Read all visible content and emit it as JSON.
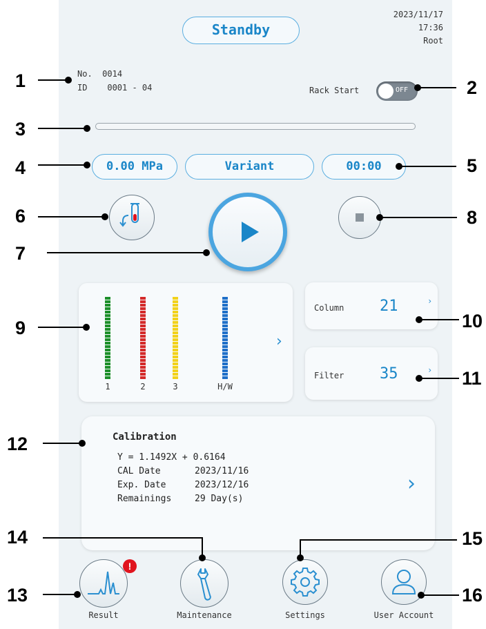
{
  "status": {
    "label": "Standby"
  },
  "header": {
    "date": "2023/11/17",
    "time": "17:36",
    "user": "Root"
  },
  "sample": {
    "no_label": "No.",
    "no_value": "0014",
    "id_label": "ID",
    "id_value": "0001 - 04"
  },
  "rack_start": {
    "label": "Rack Start",
    "toggle_text": "OFF",
    "state": "off"
  },
  "progress": {
    "value": 0
  },
  "pressure": {
    "value": "0.00 MPa"
  },
  "mode": {
    "value": "Variant"
  },
  "timer": {
    "value": "00:00"
  },
  "reagents": {
    "labels": [
      "1",
      "2",
      "3",
      "H/W"
    ],
    "colors": [
      "#1d8f2a",
      "#d42a2a",
      "#f2d21b",
      "#1f6fc8"
    ],
    "levels": [
      1.0,
      1.0,
      1.0,
      1.0
    ]
  },
  "column": {
    "label": "Column",
    "value": "21"
  },
  "filter": {
    "label": "Filter",
    "value": "35"
  },
  "calibration": {
    "title": "Calibration",
    "equation": "Y =  1.1492X + 0.6164",
    "cal_date_label": "CAL Date",
    "cal_date": "2023/11/16",
    "exp_date_label": "Exp. Date",
    "exp_date": "2023/12/16",
    "remain_label": "Remainings",
    "remain": "29 Day(s)"
  },
  "nav": {
    "result": "Result",
    "maintenance": "Maintenance",
    "settings": "Settings",
    "user_account": "User Account",
    "alert_badge": "!"
  },
  "callouts": {
    "n1": "1",
    "n2": "2",
    "n3": "3",
    "n4": "4",
    "n5": "5",
    "n6": "6",
    "n7": "7",
    "n8": "8",
    "n9": "9",
    "n10": "10",
    "n11": "11",
    "n12": "12",
    "n13": "13",
    "n14": "14",
    "n15": "15",
    "n16": "16"
  },
  "colors": {
    "accent": "#1a86c8",
    "screen_bg": "#eef3f6",
    "alert": "#e0141e"
  }
}
